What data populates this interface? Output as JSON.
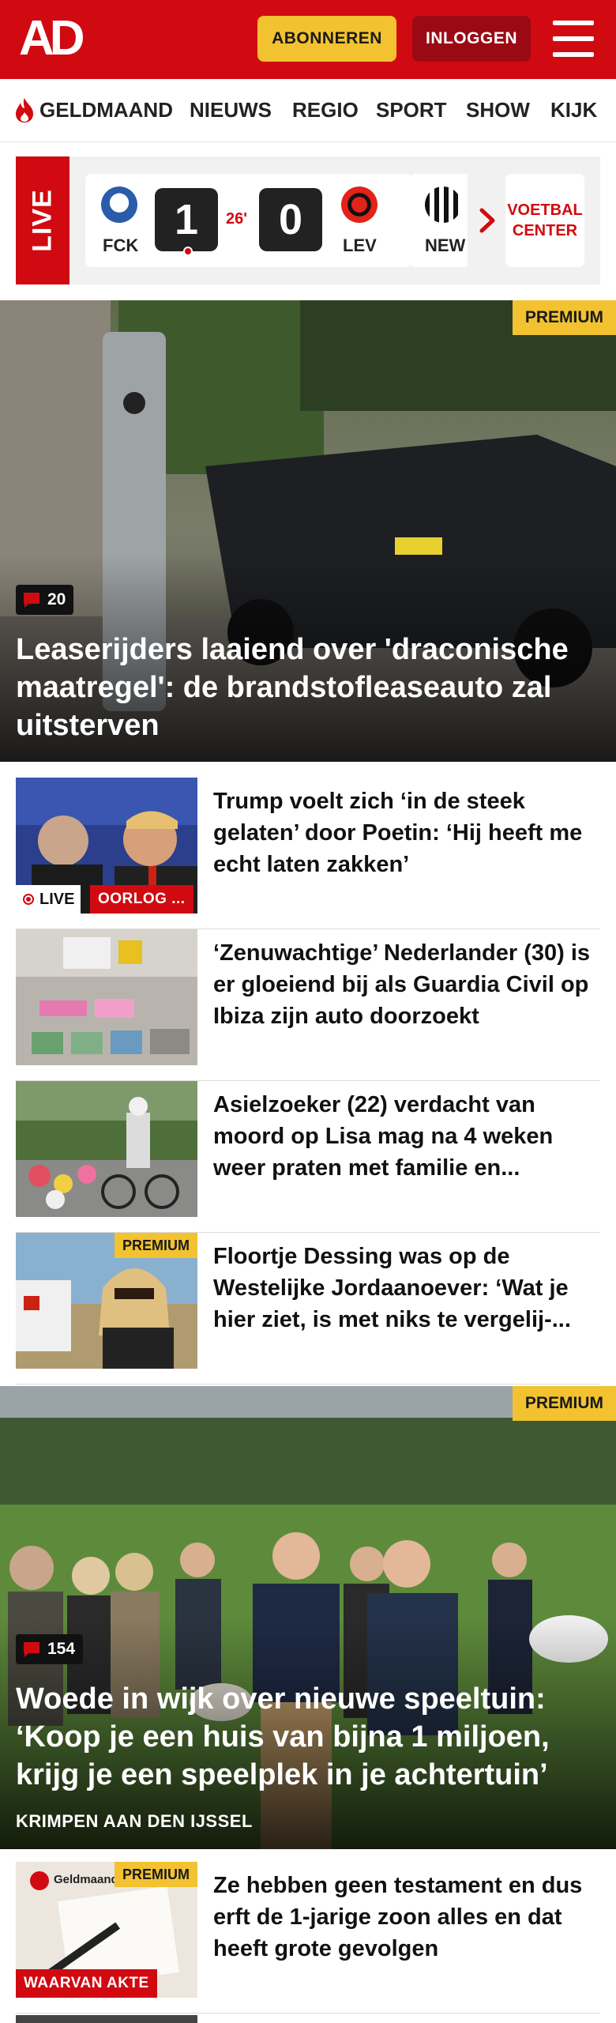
{
  "header": {
    "logo": "AD",
    "subscribe_label": "ABONNEREN",
    "login_label": "INLOGGEN"
  },
  "nav": {
    "items": [
      "GELDMAAND",
      "NIEUWS",
      "REGIO",
      "SPORT",
      "SHOW",
      "KIJK"
    ]
  },
  "live": {
    "label": "LIVE",
    "match": {
      "home_code": "FCK",
      "away_code": "LEV",
      "home_score": "1",
      "away_score": "0",
      "minute": "26'"
    },
    "next_team_code": "NEW",
    "center_label": "VOETBAL CENTER"
  },
  "hero1": {
    "badge": "PREMIUM",
    "comment_count": "20",
    "title": "Leaserijders laaiend over 'draconi­sche maatregel': de brandstoflease­auto zal uitsterven"
  },
  "articles": [
    {
      "title": "Trump voelt zich ‘in de steek gelaten’ door Poetin: ‘Hij heeft me echt laten zakken’",
      "live_label": "LIVE",
      "tag": "OORLOG ..."
    },
    {
      "title": "‘Zenuwachtige’ Nederlander (30) is er gloeiend bij als Guardia Civil op Ibiza zijn auto doorzoekt"
    },
    {
      "title": "Asielzoeker (22) verdacht van moord op Lisa mag na 4 weken weer praten met familie en..."
    },
    {
      "title": "Floortje Dessing was op de Westelijke Jordaanoever: ‘Wat je hier ziet, is met niks te vergelij-...",
      "badge": "PREMIUM"
    }
  ],
  "hero2": {
    "badge": "PREMIUM",
    "comment_count": "154",
    "title": "Woede in wijk over nieuwe speeltuin: ‘Koop je een huis van bijna 1 miljoen, krijg je een speelplek in je achtertuin’",
    "location": "KRIMPEN AAN DEN IJSSEL"
  },
  "article_last": {
    "title": "Ze hebben geen testament en dus erft de 1-jarige zoon alles en dat heeft grote gevolgen",
    "badge": "PREMIUM",
    "tag": "WAARVAN AKTE",
    "thumb_text": "Geldmaand"
  },
  "colors": {
    "brand_red": "#d10a11",
    "premium_yellow": "#f2c230",
    "login_dark_red": "#9b0a14"
  }
}
